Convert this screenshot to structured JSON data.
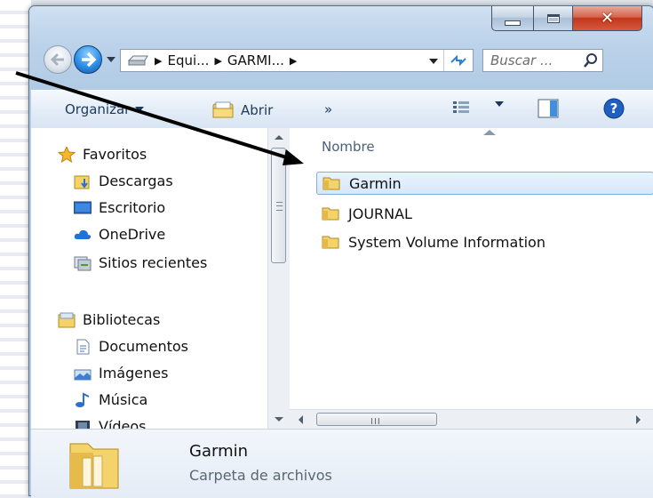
{
  "address_bar": {
    "crumbs": [
      "Equi...",
      "GARMI..."
    ],
    "search_placeholder": "Buscar ..."
  },
  "command_bar": {
    "organize_label": "Organizar",
    "open_label": "Abrir",
    "more_label": "»"
  },
  "navigation_pane": {
    "favorites_label": "Favoritos",
    "favorites": [
      "Descargas",
      "Escritorio",
      "OneDrive",
      "Sitios recientes"
    ],
    "libraries_label": "Bibliotecas",
    "libraries": [
      "Documentos",
      "Imágenes",
      "Música",
      "Vídeos"
    ]
  },
  "file_list": {
    "column_header": "Nombre",
    "items": [
      {
        "name": "Garmin",
        "selected": true
      },
      {
        "name": "JOURNAL",
        "selected": false
      },
      {
        "name": "System Volume Information",
        "selected": false
      }
    ]
  },
  "hscroll_grip": "III",
  "details_pane": {
    "title": "Garmin",
    "subtitle": "Carpeta de archivos"
  },
  "colors": {
    "folder_yellow": "#f4d36b",
    "selection_border": "#84acdd",
    "close_red": "#c1371c",
    "command_text": "#1e395b"
  }
}
